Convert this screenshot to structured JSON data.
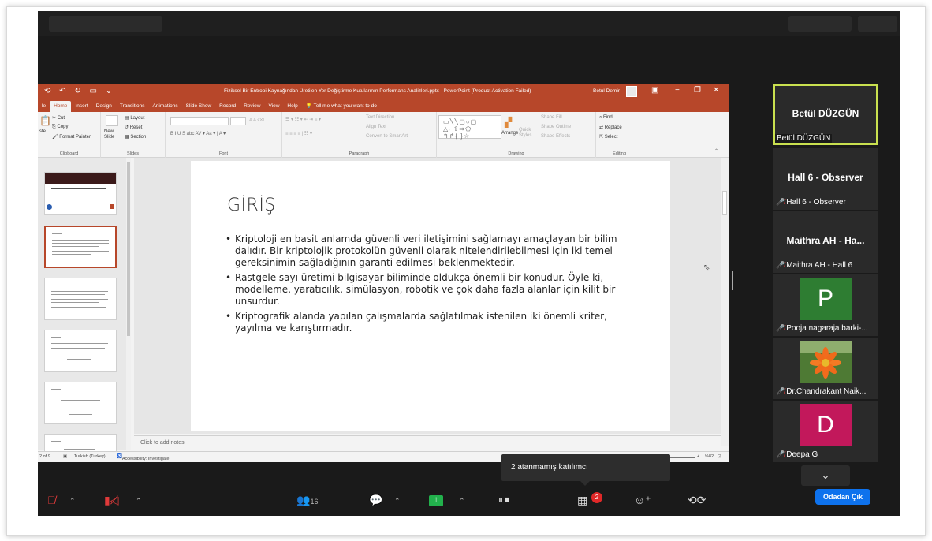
{
  "powerpoint": {
    "document_title": "Fiziksel Bir Entropi Kaynağından Üretilen Yer Değiştirme Kutularının Performans Analizleri.pptx  -  PowerPoint (Product Activation Failed)",
    "user_name": "Betul Demir",
    "tabs": [
      "le",
      "Home",
      "Insert",
      "Design",
      "Transitions",
      "Animations",
      "Slide Show",
      "Record",
      "Review",
      "View",
      "Help",
      "Tell me what you want to do"
    ],
    "ribbon": {
      "clipboard": {
        "cut": "Cut",
        "copy": "Copy",
        "paste": "ste",
        "format_painter": "Format Painter",
        "label": "Clipboard"
      },
      "slides": {
        "new_slide": "New Slide",
        "layout": "Layout",
        "reset": "Reset",
        "section": "Section",
        "label": "Slides"
      },
      "font": {
        "label": "Font"
      },
      "paragraph": {
        "text_direction": "Text Direction",
        "align_text": "Align Text",
        "convert_smartart": "Convert to SmartArt",
        "label": "Paragraph"
      },
      "drawing": {
        "arrange": "Arrange",
        "quick_styles": "Quick Styles",
        "shape_fill": "Shape Fill",
        "shape_outline": "Shape Outline",
        "shape_effects": "Shape Effects",
        "label": "Drawing"
      },
      "editing": {
        "find": "Find",
        "replace": "Replace",
        "select": "Select",
        "label": "Editing"
      }
    },
    "slide": {
      "title": "GİRİŞ",
      "bullets": [
        "Kriptoloji en basit anlamda güvenli veri iletişimini sağlamayı amaçlayan bir bilim dalıdır. Bir kriptolojik protokolün güvenli olarak nitelendirilebilmesi için iki temel gereksinimin sağladığının garanti edilmesi beklenmektedir.",
        "Rastgele sayı üretimi bilgisayar biliminde oldukça önemli bir konudur. Öyle ki, modelleme, yaratıcılık, simülasyon, robotik ve çok daha fazla alanlar için kilit bir unsurdur.",
        "Kriptografik alanda yapılan çalışmalarda sağlatılmak istenilen iki önemli kriter, yayılma ve karıştırmadır."
      ]
    },
    "notes_placeholder": "Click to add notes",
    "status": {
      "slide": "2 of 9",
      "language": "Turkish (Turkey)",
      "accessibility": "Accessibility: Investigate",
      "zoom": "%82"
    }
  },
  "tooltip": {
    "text": "2 atanmamış katılımcı"
  },
  "participants": [
    {
      "name": "Betül DÜZGÜN",
      "label": "Betül DÜZGÜN",
      "muted": false,
      "active": true
    },
    {
      "name": "Hall 6 - Observer",
      "label": "Hall 6 - Observer",
      "muted": true,
      "active": false
    },
    {
      "name": "Maithra AH - Ha...",
      "label": "Maithra AH - Hall 6",
      "muted": true,
      "active": false
    },
    {
      "name": "",
      "label": "Pooja nagaraja barki-...",
      "muted": true,
      "avatar_letter": "P",
      "avatar_color": "#2e7d32"
    },
    {
      "name": "",
      "label": "Dr.Chandrakant Naik...",
      "muted": true,
      "avatar": "flower-photo"
    },
    {
      "name": "",
      "label": "Deepa G",
      "muted": true,
      "avatar_letter": "D",
      "avatar_color": "#c2185b"
    }
  ],
  "toolbar": {
    "participants_count": "16",
    "reactions_badge": "2",
    "leave_label": "Odadan Çık"
  },
  "colors": {
    "ppt_accent": "#b7472a",
    "zoom_bg": "#1a1a1a",
    "active_speaker": "#c9e04f",
    "leave_blue": "#0e72ed",
    "share_green": "#22b14c"
  }
}
